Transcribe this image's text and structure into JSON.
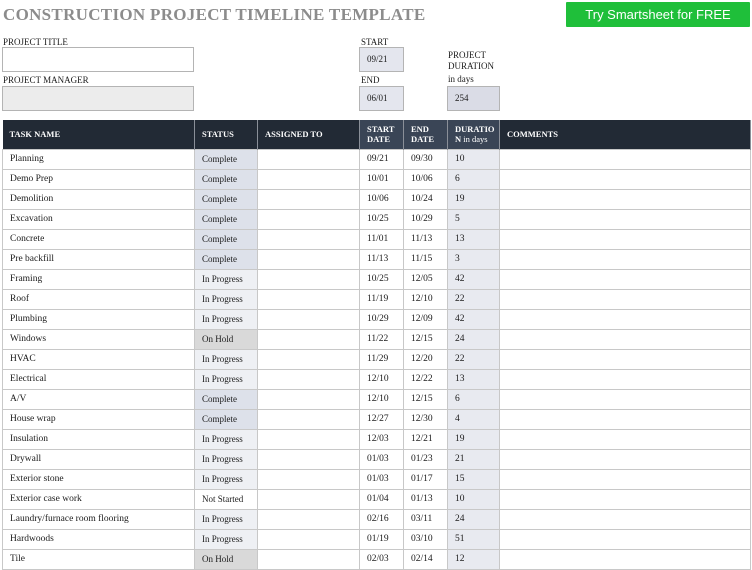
{
  "header": {
    "title": "CONSTRUCTION PROJECT TIMELINE TEMPLATE",
    "cta_label": "Try Smartsheet for FREE"
  },
  "project": {
    "title_label": "PROJECT TITLE",
    "title_value": "",
    "manager_label": "PROJECT MANAGER",
    "manager_value": "",
    "start_label": "START",
    "start_value": "09/21",
    "end_label": "END",
    "end_value": "06/01",
    "duration_label_1": "PROJECT",
    "duration_label_2": "DURATION",
    "duration_label_3": "in days",
    "duration_value": "254"
  },
  "table": {
    "headers": {
      "task": "TASK NAME",
      "status": "STATUS",
      "assigned": "ASSIGNED TO",
      "start_1": "START",
      "start_2": "DATE",
      "end_1": "END",
      "end_2": "DATE",
      "duration_1": "DURATIO",
      "duration_2": "N",
      "duration_3": " in days",
      "comments": "COMMENTS"
    },
    "rows": [
      {
        "task": "Planning",
        "status": "Complete",
        "assigned": "",
        "start": "09/21",
        "end": "09/30",
        "duration": "10",
        "comments": ""
      },
      {
        "task": "Demo Prep",
        "status": "Complete",
        "assigned": "",
        "start": "10/01",
        "end": "10/06",
        "duration": "6",
        "comments": ""
      },
      {
        "task": "Demolition",
        "status": "Complete",
        "assigned": "",
        "start": "10/06",
        "end": "10/24",
        "duration": "19",
        "comments": ""
      },
      {
        "task": "Excavation",
        "status": "Complete",
        "assigned": "",
        "start": "10/25",
        "end": "10/29",
        "duration": "5",
        "comments": ""
      },
      {
        "task": "Concrete",
        "status": "Complete",
        "assigned": "",
        "start": "11/01",
        "end": "11/13",
        "duration": "13",
        "comments": ""
      },
      {
        "task": "Pre backfill",
        "status": "Complete",
        "assigned": "",
        "start": "11/13",
        "end": "11/15",
        "duration": "3",
        "comments": ""
      },
      {
        "task": "Framing",
        "status": "In Progress",
        "assigned": "",
        "start": "10/25",
        "end": "12/05",
        "duration": "42",
        "comments": ""
      },
      {
        "task": "Roof",
        "status": "In Progress",
        "assigned": "",
        "start": "11/19",
        "end": "12/10",
        "duration": "22",
        "comments": ""
      },
      {
        "task": "Plumbing",
        "status": "In Progress",
        "assigned": "",
        "start": "10/29",
        "end": "12/09",
        "duration": "42",
        "comments": ""
      },
      {
        "task": "Windows",
        "status": "On Hold",
        "assigned": "",
        "start": "11/22",
        "end": "12/15",
        "duration": "24",
        "comments": ""
      },
      {
        "task": "HVAC",
        "status": "In Progress",
        "assigned": "",
        "start": "11/29",
        "end": "12/20",
        "duration": "22",
        "comments": ""
      },
      {
        "task": "Electrical",
        "status": "In Progress",
        "assigned": "",
        "start": "12/10",
        "end": "12/22",
        "duration": "13",
        "comments": ""
      },
      {
        "task": "A/V",
        "status": "Complete",
        "assigned": "",
        "start": "12/10",
        "end": "12/15",
        "duration": "6",
        "comments": ""
      },
      {
        "task": "House wrap",
        "status": "Complete",
        "assigned": "",
        "start": "12/27",
        "end": "12/30",
        "duration": "4",
        "comments": ""
      },
      {
        "task": "Insulation",
        "status": "In Progress",
        "assigned": "",
        "start": "12/03",
        "end": "12/21",
        "duration": "19",
        "comments": ""
      },
      {
        "task": "Drywall",
        "status": "In Progress",
        "assigned": "",
        "start": "01/03",
        "end": "01/23",
        "duration": "21",
        "comments": ""
      },
      {
        "task": "Exterior stone",
        "status": "In Progress",
        "assigned": "",
        "start": "01/03",
        "end": "01/17",
        "duration": "15",
        "comments": ""
      },
      {
        "task": "Exterior case work",
        "status": "Not Started",
        "assigned": "",
        "start": "01/04",
        "end": "01/13",
        "duration": "10",
        "comments": ""
      },
      {
        "task": "Laundry/furnace room flooring",
        "status": "In Progress",
        "assigned": "",
        "start": "02/16",
        "end": "03/11",
        "duration": "24",
        "comments": ""
      },
      {
        "task": "Hardwoods",
        "status": "In Progress",
        "assigned": "",
        "start": "01/19",
        "end": "03/10",
        "duration": "51",
        "comments": ""
      },
      {
        "task": "Tile",
        "status": "On Hold",
        "assigned": "",
        "start": "02/03",
        "end": "02/14",
        "duration": "12",
        "comments": ""
      }
    ]
  },
  "colors": {
    "header_bg": "#222a35",
    "cta_bg": "#1fbf3a",
    "status_complete": "#dde1ea",
    "status_in_progress": "#eef0f4",
    "status_on_hold": "#d9d9d9",
    "status_not_started": "#ffffff"
  }
}
